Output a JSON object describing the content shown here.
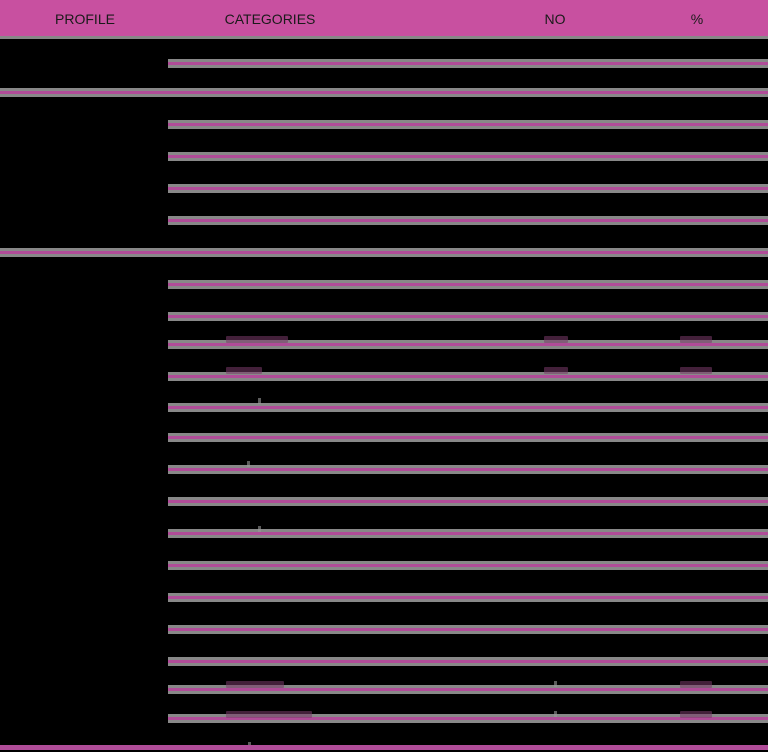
{
  "table": {
    "header": {
      "profile": "PROFILE",
      "categories": "CATEGORIES",
      "no": "NO",
      "percent": "%"
    },
    "colors": {
      "header_background": "#c850a0",
      "separator_pink": "#b04c98",
      "separator_gray": "#888888",
      "body_background": "#000000"
    }
  }
}
